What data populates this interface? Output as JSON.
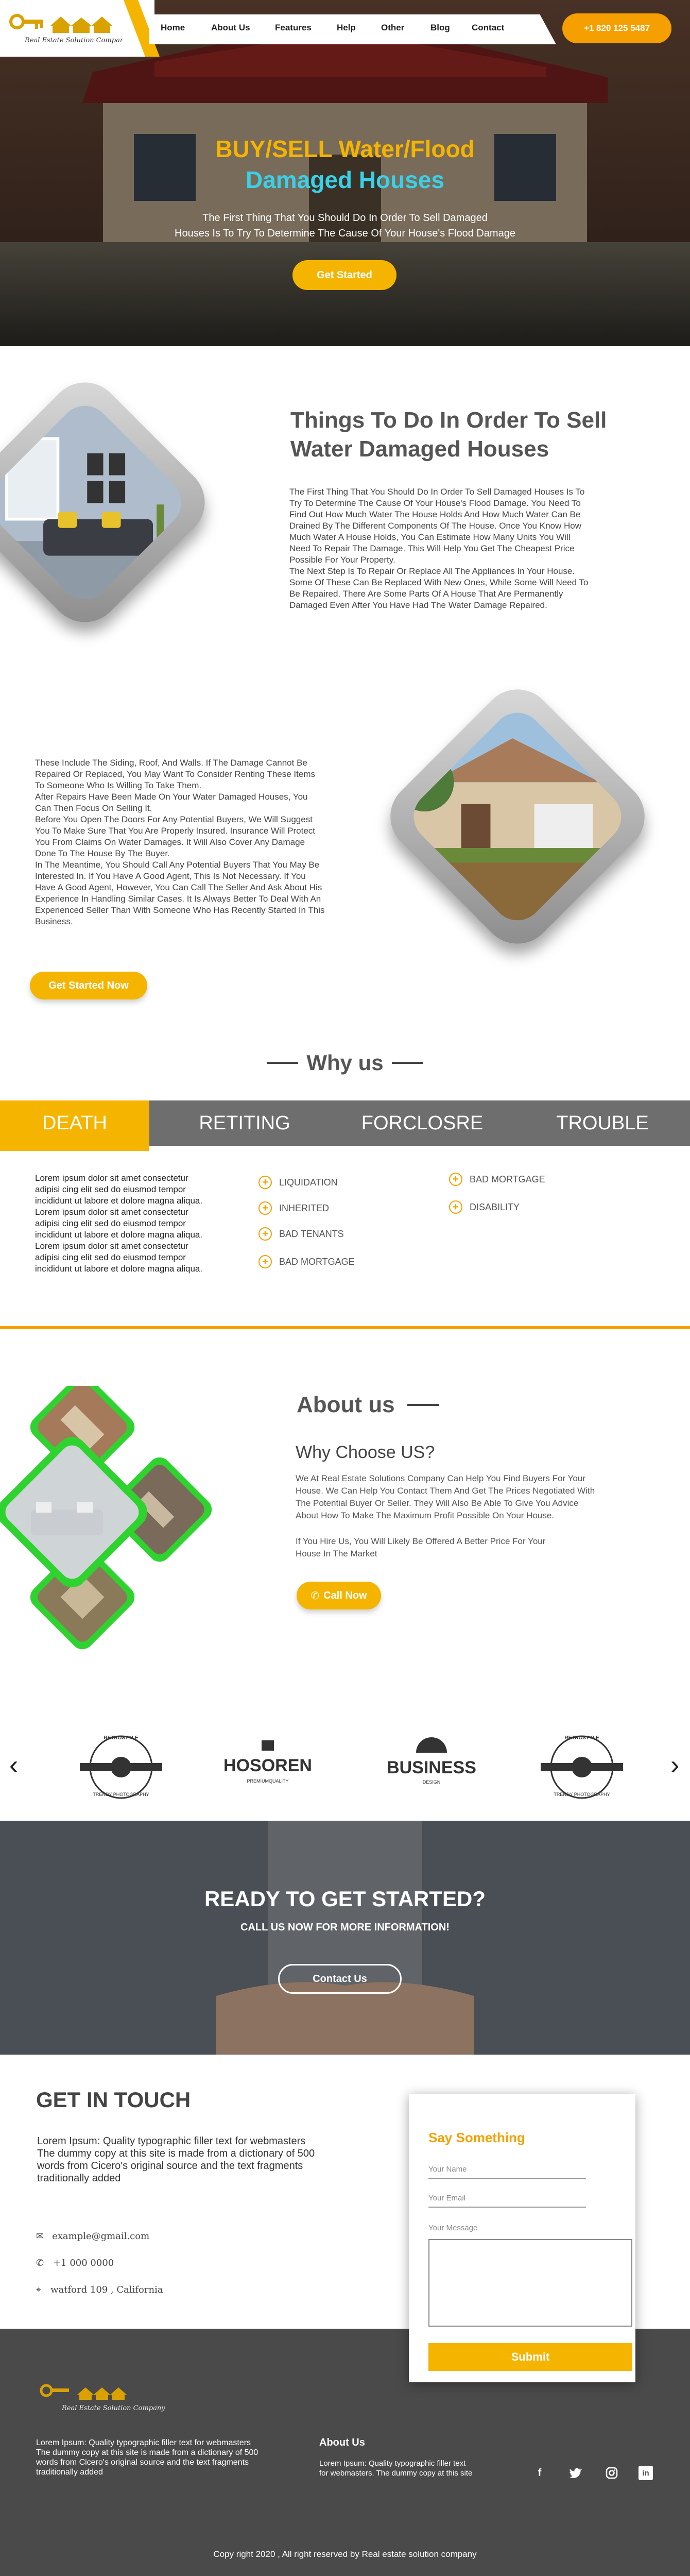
{
  "header": {
    "logo_text": "Real Estate Solution Company",
    "nav": [
      "Home",
      "About Us",
      "Features",
      "Help",
      "Other",
      "Blog",
      "Contact"
    ],
    "phone": "+1 820 125 5487"
  },
  "hero": {
    "title_line1": "BUY/SELL Water/Flood",
    "title_line2": "Damaged Houses",
    "subtitle_line1": "The First Thing That You Should Do In Order To Sell Damaged",
    "subtitle_line2": "Houses Is To Try To Determine The Cause Of Your House's Flood Damage",
    "cta": "Get Started"
  },
  "things": {
    "title_line1": "Things To Do In Order To Sell",
    "title_line2": "Water Damaged Houses",
    "paragraph": [
      "The First Thing That You Should Do In Order To Sell Damaged Houses Is To",
      "Try To Determine The Cause Of Your House's Flood Damage. You Need To",
      "Find Out How Much Water The House Holds And How Much Water Can Be",
      "Drained By The Different Components Of The House. Once You Know How",
      "Much Water A House Holds, You Can Estimate How Many Units You Will",
      "Need To Repair The Damage. This Will Help You Get The Cheapest Price",
      "Possible For Your Property.",
      "The Next Step Is To Repair Or Replace All The Appliances In Your House.",
      "Some Of These Can Be Replaced With New Ones, While Some Will Need To",
      "Be Repaired. There Are Some Parts Of A House That Are Permanently",
      "Damaged Even After You Have Had The Water Damage Repaired."
    ]
  },
  "second": {
    "paragraph": [
      "These Include The Siding, Roof, And Walls. If The Damage Cannot Be",
      "Repaired Or Replaced, You May Want To Consider Renting These Items",
      "To Someone Who Is Willing To Take Them.",
      "After Repairs Have Been Made On Your Water Damaged Houses, You",
      "Can Then Focus On Selling It.",
      "Before You Open The Doors For Any Potential Buyers, We Will Suggest",
      "You To Make Sure That You Are Properly Insured. Insurance Will Protect",
      "You From Claims On Water Damages. It Will Also Cover Any Damage",
      "Done To The House By The Buyer.",
      "In The Meantime, You Should Call Any Potential Buyers That You May Be",
      "Interested In. If You Have A Good Agent, This Is Not Necessary. If You",
      "Have A Good Agent, However, You Can Call The Seller And Ask About His",
      "Experience In Handling Similar Cases. It Is Always Better To Deal With An",
      "Experienced Seller Than With Someone Who Has Recently Started In This",
      "Business."
    ],
    "cta": "Get Started Now"
  },
  "why": {
    "title": "Why us",
    "tabs": [
      "DEATH",
      "RETITING",
      "FORCLOSRE",
      "TROUBLE"
    ],
    "lorem": [
      "Lorem ipsum dolor sit amet consectetur",
      "adipisi cing elit sed do eiusmod tempor",
      "incididunt ut labore et dolore magna aliqua.",
      "Lorem ipsum dolor sit amet consectetur",
      "adipisi cing elit sed do eiusmod tempor",
      "incididunt ut labore et dolore magna aliqua.",
      "Lorem ipsum dolor sit amet consectetur",
      "adipisi cing elit sed do eiusmod tempor",
      "incididunt ut labore et dolore magna aliqua."
    ],
    "list_col1": [
      "LIQUIDATION",
      "INHERITED",
      "BAD TENANTS",
      "BAD MORTGAGE"
    ],
    "list_col2": [
      "BAD MORTGAGE",
      "DISABILITY"
    ]
  },
  "about": {
    "title": "About us",
    "subtitle": "Why Choose US?",
    "para1": [
      "We At Real Estate Solutions Company Can Help You Find Buyers For Your",
      "House. We Can Help You Contact Them And Get The Prices Negotiated With",
      "The Potential Buyer Or Seller. They Will Also Be Able To Give You Advice",
      "About How To Make The Maximum Profit Possible On Your House."
    ],
    "para2": [
      "If You Hire Us, You Will Likely Be Offered A Better Price For Your",
      "House In The Market"
    ],
    "cta": "Call Now"
  },
  "logos": {
    "prev": "‹",
    "next": "›",
    "items": [
      {
        "top": "RETROSTYLE",
        "main": "",
        "bottom": "TRENDY PHOTOGRAPHY"
      },
      {
        "top": "",
        "main": "HOSOREN",
        "bottom": "PREMIUMQUALITY"
      },
      {
        "top": "",
        "main": "BUSINESS",
        "bottom": "DESIGN"
      },
      {
        "top": "RETROSTYLE",
        "main": "",
        "bottom": "TRENDY PHOTOGRAPHY"
      }
    ]
  },
  "ready": {
    "title": "READY TO GET STARTED?",
    "subtitle": "CALL US NOW FOR MORE INFORMATION!",
    "cta": "Contact Us"
  },
  "contact": {
    "title": "GET IN TOUCH",
    "text": [
      "Lorem Ipsum: Quality typographic filler text for webmasters",
      "The dummy copy at this site is made from a dictionary of 500",
      "words from Cicero's original source and the text fragments",
      "traditionally added"
    ],
    "email": "example@gmail.com",
    "phone": "+1 000 0000",
    "address": "watford 109 , California",
    "form_title": "Say Something",
    "name_placeholder": "Your Name",
    "email_placeholder": "Your Email",
    "message_placeholder": "Your Message",
    "submit": "Submit"
  },
  "footer": {
    "logo_text": "Real Estate Solution Company",
    "text": [
      "Lorem Ipsum: Quality typographic filler text for webmasters",
      "The dummy copy at this site is made from a dictionary of 500",
      "words from Cicero's original source and the text fragments",
      "traditionally added"
    ],
    "about_title": "About Us",
    "about_text": [
      "Lorem Ipsum: Quality typographic filler text",
      "for webmasters. The dummy copy at this site"
    ],
    "social": [
      "f",
      "t",
      "ig",
      "in"
    ],
    "copyright": "Copy right  2020 , All right reserved by Real estate solution company"
  },
  "colors": {
    "accent": "#f5b400",
    "accent_dark": "#f5a000",
    "tab_bar": "#6e6e6e",
    "footer": "#4a4a4a",
    "green_frame": "#2fd32f",
    "hero_title2": "#39d0e8"
  }
}
